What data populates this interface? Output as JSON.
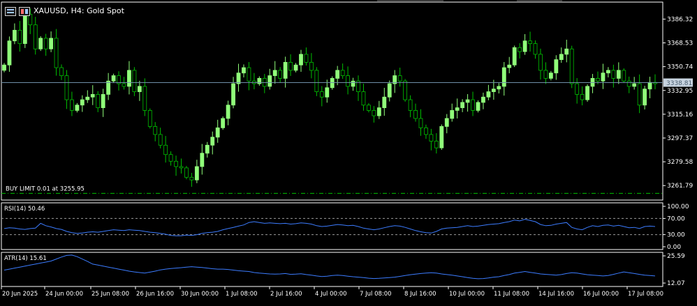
{
  "header": {
    "title": "XAUUSD, H4:  Gold Spot"
  },
  "order_line": {
    "label": "BUY LIMIT 0.01 at 3255.95",
    "price": 3255.95,
    "color": "#00c000"
  },
  "colors": {
    "background": "#000000",
    "bull_candle": "#90ff7a",
    "bear_candle": "#000000",
    "bear_outline": "#00c000",
    "bid_line": "#6f8fa8",
    "indicator_line": "#3c7cff",
    "axis_text": "#ffffff",
    "frame": "#ffffff"
  },
  "chart_data": [
    {
      "type": "candlestick",
      "title": "XAUUSD, H4:  Gold Spot",
      "ylim": [
        3252,
        3398
      ],
      "y_ticks": [
        3386.32,
        3368.53,
        3350.74,
        3332.95,
        3315.16,
        3297.37,
        3279.58,
        3261.79
      ],
      "y_tick_labels": [
        "3386.32",
        "3368.53",
        "3350.74",
        "3332.95",
        "3315.16",
        "3297.37",
        "3279.58",
        "3261.79"
      ],
      "current_price": 3338.81,
      "current_price_label": "3338.81",
      "x_labels": [
        "20 Jun 2025",
        "24 Jun 00:00",
        "25 Jun 08:00",
        "26 Jun 16:00",
        "30 Jun 00:00",
        "1 Jul 08:00",
        "2 Jul 16:00",
        "4 Jul 00:00",
        "7 Jul 08:00",
        "8 Jul 16:00",
        "10 Jul 00:00",
        "11 Jul 08:00",
        "14 Jul 16:00",
        "16 Jul 00:00",
        "17 Jul 08:00"
      ],
      "closes": [
        3352,
        3370,
        3378,
        3368,
        3390,
        3382,
        3364,
        3372,
        3364,
        3372,
        3350,
        3344,
        3326,
        3318,
        3322,
        3326,
        3328,
        3330,
        3320,
        3330,
        3340,
        3344,
        3338,
        3336,
        3348,
        3332,
        3336,
        3318,
        3306,
        3300,
        3292,
        3285,
        3280,
        3276,
        3275,
        3268,
        3266,
        3276,
        3286,
        3292,
        3298,
        3305,
        3312,
        3322,
        3338,
        3346,
        3350,
        3340,
        3338,
        3342,
        3336,
        3344,
        3348,
        3342,
        3354,
        3348,
        3352,
        3360,
        3354,
        3348,
        3332,
        3328,
        3335,
        3342,
        3348,
        3344,
        3336,
        3340,
        3332,
        3322,
        3318,
        3314,
        3320,
        3328,
        3338,
        3344,
        3340,
        3326,
        3318,
        3312,
        3305,
        3300,
        3295,
        3290,
        3306,
        3312,
        3318,
        3320,
        3324,
        3326,
        3318,
        3324,
        3328,
        3332,
        3334,
        3336,
        3350,
        3352,
        3365,
        3362,
        3370,
        3368,
        3360,
        3348,
        3342,
        3346,
        3356,
        3360,
        3364,
        3338,
        3330,
        3326,
        3336,
        3342,
        3340,
        3346,
        3348,
        3342,
        3348,
        3340,
        3336,
        3338,
        3322,
        3334,
        3339,
        3338
      ]
    },
    {
      "type": "line",
      "title": "RSI(14) 50.46",
      "series": [
        {
          "name": "RSI(14)",
          "values": [
            45,
            47,
            46,
            44,
            43,
            45,
            46,
            58,
            52,
            49,
            45,
            43,
            38,
            35,
            33,
            34,
            36,
            37,
            36,
            38,
            40,
            42,
            41,
            40,
            42,
            41,
            40,
            38,
            36,
            35,
            33,
            31,
            28,
            27,
            27,
            29,
            28,
            30,
            33,
            35,
            36,
            38,
            42,
            45,
            48,
            51,
            54,
            60,
            62,
            60,
            58,
            59,
            58,
            57,
            58,
            56,
            57,
            59,
            58,
            56,
            52,
            50,
            51,
            53,
            55,
            54,
            52,
            53,
            50,
            46,
            44,
            42,
            44,
            47,
            50,
            52,
            51,
            48,
            44,
            40,
            37,
            35,
            34,
            38,
            44,
            46,
            47,
            48,
            50,
            52,
            50,
            51,
            53,
            55,
            56,
            57,
            60,
            62,
            66,
            64,
            68,
            65,
            62,
            55,
            52,
            53,
            56,
            58,
            60,
            48,
            44,
            42,
            48,
            52,
            50,
            53,
            54,
            51,
            53,
            50,
            47,
            48,
            45,
            50,
            51,
            50
          ]
        }
      ],
      "y_ticks": [
        100,
        70,
        30,
        0
      ],
      "y_tick_labels": [
        "100.00",
        "70.00",
        "30.00",
        "0.00"
      ],
      "levels": [
        70,
        30
      ],
      "ylim": [
        0,
        100
      ]
    },
    {
      "type": "line",
      "title": "ATR(14) 15.61",
      "series": [
        {
          "name": "ATR(14)",
          "values": [
            18.5,
            19,
            19.5,
            20,
            20.5,
            21,
            21.5,
            22,
            22.5,
            23,
            24,
            25,
            25.8,
            26,
            25.2,
            24,
            22.8,
            21.5,
            21,
            20.5,
            20,
            19.5,
            19,
            18.5,
            18,
            17.6,
            17.3,
            17,
            17.5,
            18,
            18.6,
            19,
            19.3,
            19.5,
            19.7,
            20,
            20.2,
            20,
            19.8,
            19.5,
            19.2,
            19,
            19,
            18.8,
            18.5,
            18.2,
            18,
            17.8,
            17.3,
            17,
            16.8,
            16.6,
            16.5,
            16.6,
            16.8,
            16.4,
            16.5,
            16.7,
            16.3,
            16,
            15.6,
            15.3,
            15.5,
            15.8,
            16,
            15.8,
            15.5,
            15.2,
            15,
            14.8,
            14.5,
            14.3,
            14.4,
            14.6,
            14.8,
            15,
            15.4,
            15.8,
            16.2,
            16.5,
            16.8,
            17,
            17.2,
            17,
            16.6,
            16.3,
            16,
            15.6,
            15.2,
            14.8,
            14.4,
            14.2,
            14.3,
            14.6,
            15,
            15.2,
            15.8,
            16.3,
            17,
            17.4,
            17.8,
            17.4,
            17,
            16.6,
            16.4,
            16.2,
            16,
            16.3,
            16.8,
            17.2,
            17,
            16.6,
            16.2,
            16,
            15.8,
            15.6,
            15.8,
            16.4,
            17,
            17.6,
            17.2,
            16.8,
            16.4,
            16,
            15.8,
            15.61
          ]
        }
      ],
      "y_ticks": [
        25.59,
        12.07
      ],
      "y_tick_labels": [
        "25.59",
        "12.07"
      ],
      "ylim": [
        11.4,
        26.3
      ]
    }
  ]
}
